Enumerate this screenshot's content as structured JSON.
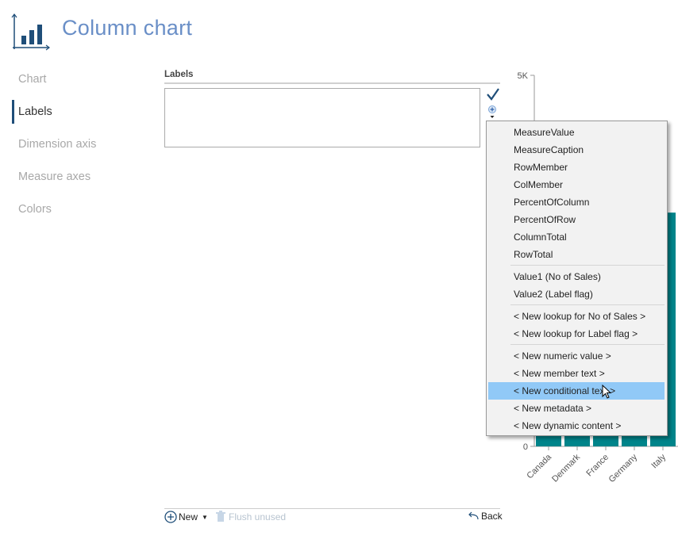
{
  "header": {
    "title": "Column chart",
    "icon": "column-chart-icon"
  },
  "sidebar": {
    "items": [
      {
        "label": "Chart",
        "active": false
      },
      {
        "label": "Labels",
        "active": true
      },
      {
        "label": "Dimension axis",
        "active": false
      },
      {
        "label": "Measure axes",
        "active": false
      },
      {
        "label": "Colors",
        "active": false
      }
    ]
  },
  "labels_panel": {
    "heading": "Labels",
    "value": ""
  },
  "menu": {
    "groups": [
      [
        "MeasureValue",
        "MeasureCaption",
        "RowMember",
        "ColMember",
        "PercentOfColumn",
        "PercentOfRow",
        "ColumnTotal",
        "RowTotal"
      ],
      [
        "Value1 (No of Sales)",
        "Value2 (Label flag)"
      ],
      [
        "< New lookup for No of Sales >",
        "< New lookup for Label flag >"
      ],
      [
        "< New numeric value >",
        "< New member text >",
        "< New conditional text >",
        "< New metadata >",
        "< New dynamic content >"
      ]
    ],
    "highlighted": "< New conditional text >"
  },
  "footer": {
    "new_label": "New",
    "flush_label": "Flush unused",
    "back_label": "Back"
  },
  "colors": {
    "accent": "#1f4e79",
    "bar": "#00848a",
    "highlight": "#91c9f7"
  },
  "chart_data": {
    "type": "bar",
    "categories": [
      "Canada",
      "Denmark",
      "France",
      "Germany",
      "Italy"
    ],
    "values": [
      null,
      null,
      null,
      null,
      3150
    ],
    "yticks": [
      "0",
      "5K"
    ],
    "ylim": [
      0,
      5000
    ]
  }
}
